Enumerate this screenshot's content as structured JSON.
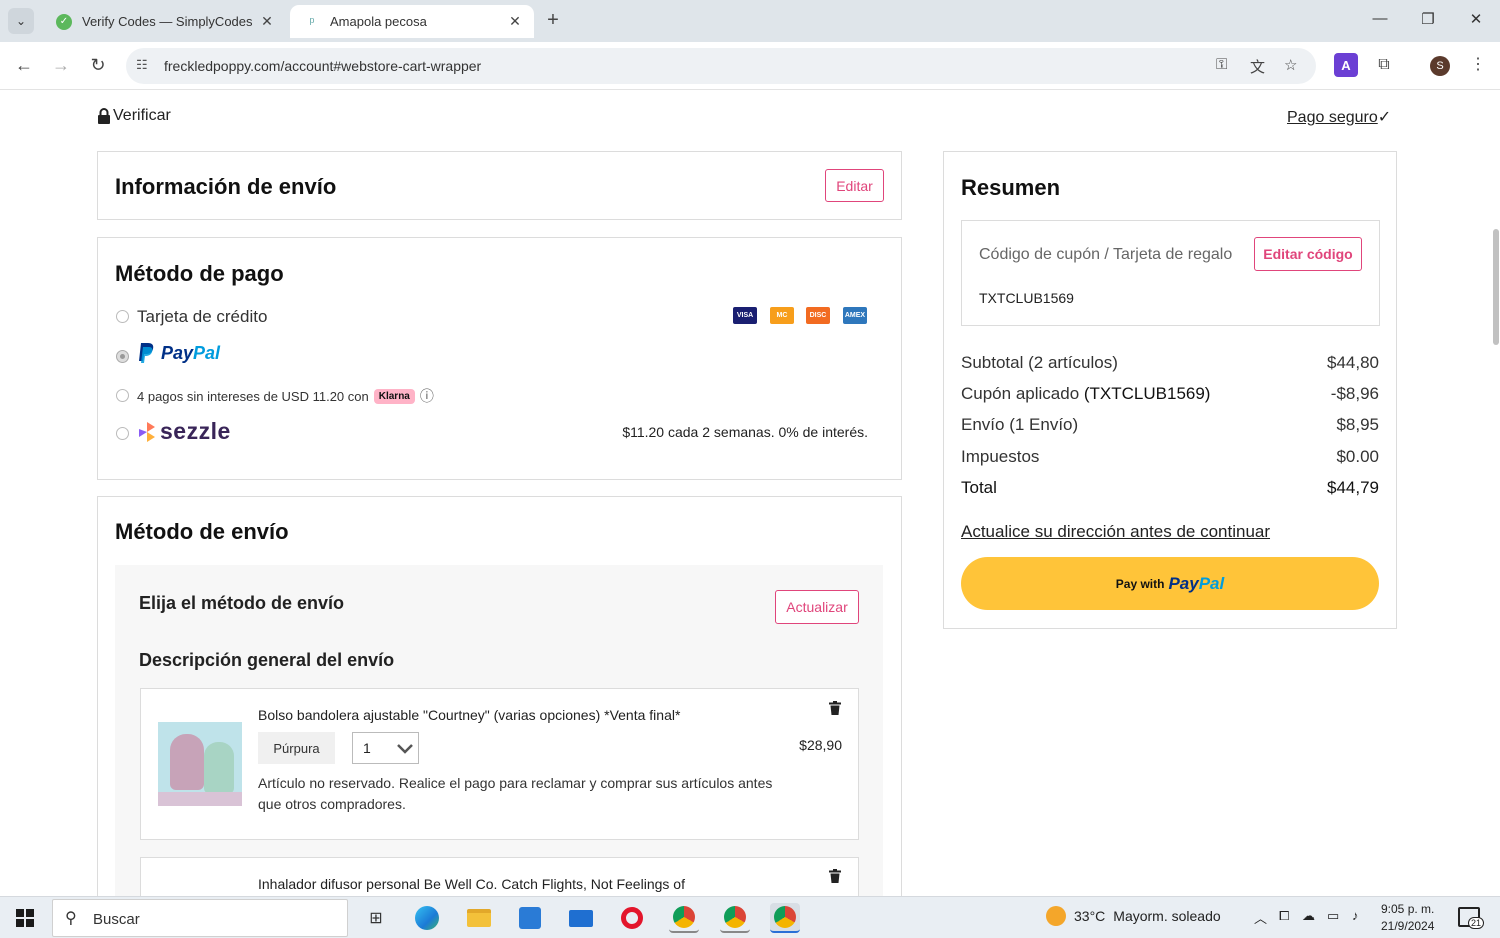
{
  "browser": {
    "tabs": [
      {
        "title": "Verify Codes — SimplyCodes",
        "active": false,
        "icon": "simplycodes-icon"
      },
      {
        "title": "Amapola pecosa",
        "active": true,
        "icon": "freckledpoppy-icon"
      }
    ],
    "url": "freckledpoppy.com/account#webstore-cart-wrapper",
    "profile_initial": "S"
  },
  "header": {
    "verify_label": "Verificar",
    "secure_label": "Pago seguro",
    "secure_check": "✓"
  },
  "shipping_info": {
    "title": "Información de envío",
    "edit_label": "Editar"
  },
  "payment": {
    "title": "Método de pago",
    "credit_card_label": "Tarjeta de crédito",
    "card_logos": [
      "VISA",
      "MC",
      "DISC",
      "AMEX"
    ],
    "paypal_logo_p": "Pay",
    "paypal_logo_pal": "Pal",
    "klarna_text": "4 pagos sin intereses de USD 11.20 con",
    "klarna_badge": "Klarna",
    "info_icon": "ⓘ",
    "sezzle_logo": "sezzle",
    "sezzle_text": "$11.20 cada 2 semanas. 0% de interés."
  },
  "shipping_method": {
    "title": "Método de envío",
    "choose_label": "Elija el método de envío",
    "update_label": "Actualizar",
    "overview_label": "Descripción general del envío",
    "items": [
      {
        "name": "Bolso bandolera ajustable \"Courtney\" (varias opciones) *Venta final*",
        "variant": "Púrpura",
        "qty": "1",
        "price": "$28,90",
        "note": "Artículo no reservado. Realice el pago para reclamar y comprar sus artículos antes que otros compradores."
      },
      {
        "name": "Inhalador difusor personal Be Well Co. Catch Flights, Not Feelings of"
      }
    ]
  },
  "summary": {
    "title": "Resumen",
    "coupon_placeholder": "Código de cupón / Tarjeta de regalo",
    "edit_code_label": "Editar código",
    "coupon_code": "TXTCLUB1569",
    "rows": [
      {
        "label": "Subtotal (2 artículos)",
        "value": "$44,80"
      },
      {
        "label_prefix": "Cupón aplicado ",
        "label_code": "(TXTCLUB1569)",
        "value": "-$8,96"
      },
      {
        "label": "Envío (1 Envío)",
        "value": "$8,95"
      },
      {
        "label": "Impuestos",
        "value": "$0.00"
      },
      {
        "label": "Total",
        "value": "$44,79"
      }
    ],
    "update_address_link": "Actualice su dirección antes de continuar",
    "paypal_pay_with": "Pay with",
    "paypal_pay": "Pay",
    "paypal_pal": "Pal"
  },
  "taskbar": {
    "search_placeholder": "Buscar",
    "weather_temp": "33°C",
    "weather_desc": "Mayorm. soleado",
    "time": "9:05 p. m.",
    "date": "21/9/2024",
    "notification_count": "21"
  },
  "colors": {
    "accent_pink": "#e0457b",
    "paypal_yellow": "#ffc439",
    "paypal_dark_blue": "#003087",
    "paypal_light_blue": "#009cde"
  }
}
